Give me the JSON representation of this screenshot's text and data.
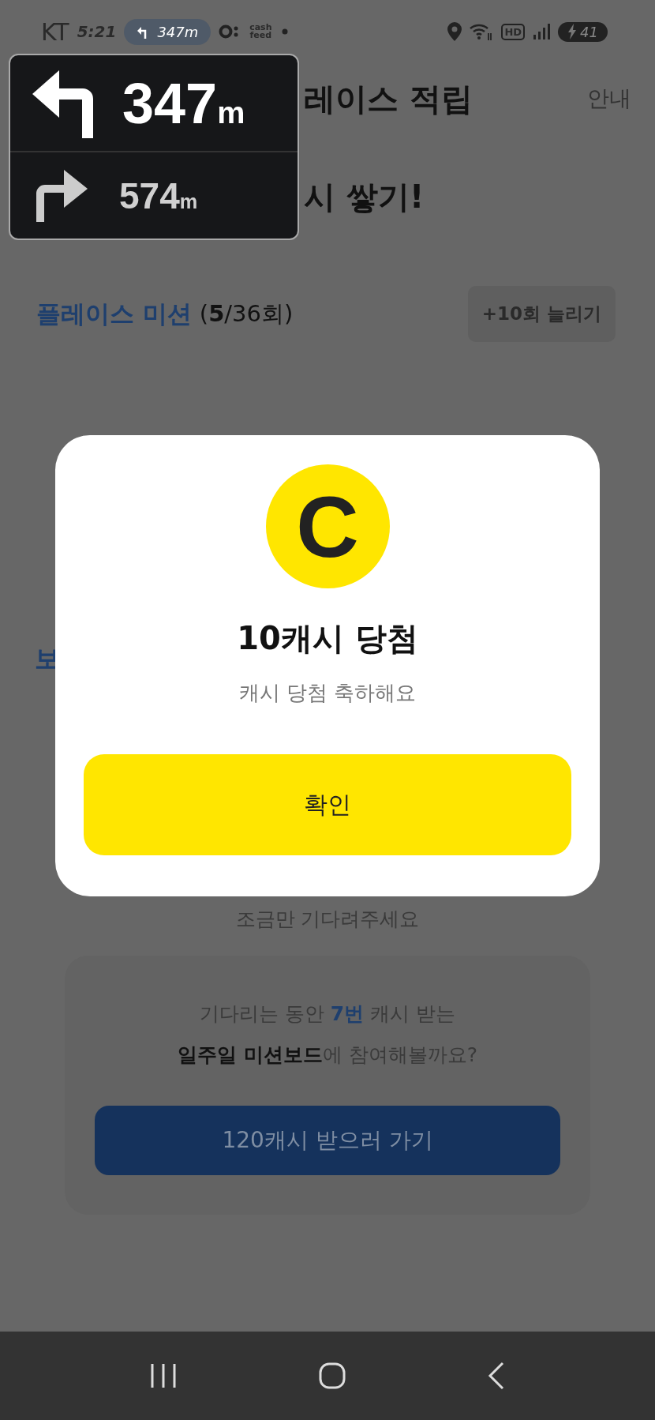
{
  "status_bar": {
    "carrier": "KT",
    "time": "5:21",
    "nav_pill": "347m",
    "app_label": "cash feed",
    "hd": "HD",
    "battery": "41"
  },
  "nav_overlay": {
    "next": {
      "distance": "347",
      "unit": "m"
    },
    "then": {
      "distance": "574",
      "unit": "m"
    }
  },
  "header": {
    "title": "레이스 적립",
    "info_link": "안내"
  },
  "headline": "시 쌓기!",
  "mission": {
    "title": "플레이스 미션",
    "count": "(**5**/36회)",
    "extend_button": "+10회 늘리기"
  },
  "section_label": "보",
  "wait_text": "조금만 기다려주세요",
  "promo": {
    "lines": [
      "기다리는 동안 **7번** 캐시 받는",
      "**일주일 미션보드**에 참여해볼까요?"
    ],
    "button": "120캐시 받으러 가기"
  },
  "dialog": {
    "coin_letter": "C",
    "title": "10캐시 당첨",
    "message": "캐시 당첨 축하해요",
    "confirm": "확인"
  },
  "nav_bar": {
    "buttons": [
      {
        "kind": "recents"
      },
      {
        "kind": "home"
      },
      {
        "kind": "back"
      }
    ]
  }
}
